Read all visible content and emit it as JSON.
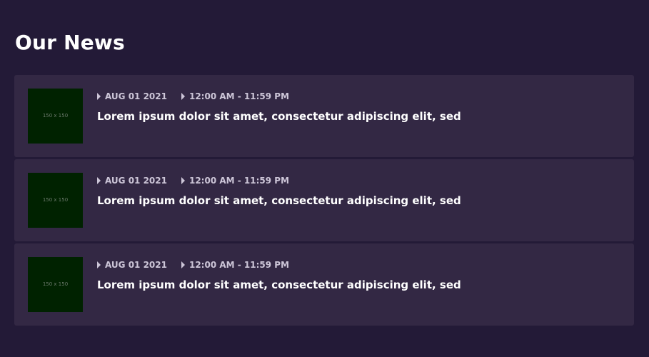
{
  "section": {
    "title": "Our News"
  },
  "news": [
    {
      "thumbnail_label": "150 x 150",
      "date": "AUG 01 2021",
      "time": "12:00 AM - 11:59 PM",
      "headline": "Lorem ipsum dolor sit amet, consectetur adipiscing elit, sed"
    },
    {
      "thumbnail_label": "150 x 150",
      "date": "AUG 01 2021",
      "time": "12:00 AM - 11:59 PM",
      "headline": "Lorem ipsum dolor sit amet, consectetur adipiscing elit, sed"
    },
    {
      "thumbnail_label": "150 x 150",
      "date": "AUG 01 2021",
      "time": "12:00 AM - 11:59 PM",
      "headline": "Lorem ipsum dolor sit amet, consectetur adipiscing elit, sed"
    }
  ],
  "icons": {
    "meta_marker": "caret-right-icon"
  },
  "colors": {
    "background": "#231a37",
    "card": "#332844",
    "thumbnail": "#002200",
    "meta_text": "#cdc6d8",
    "headline_text": "#ffffff"
  }
}
